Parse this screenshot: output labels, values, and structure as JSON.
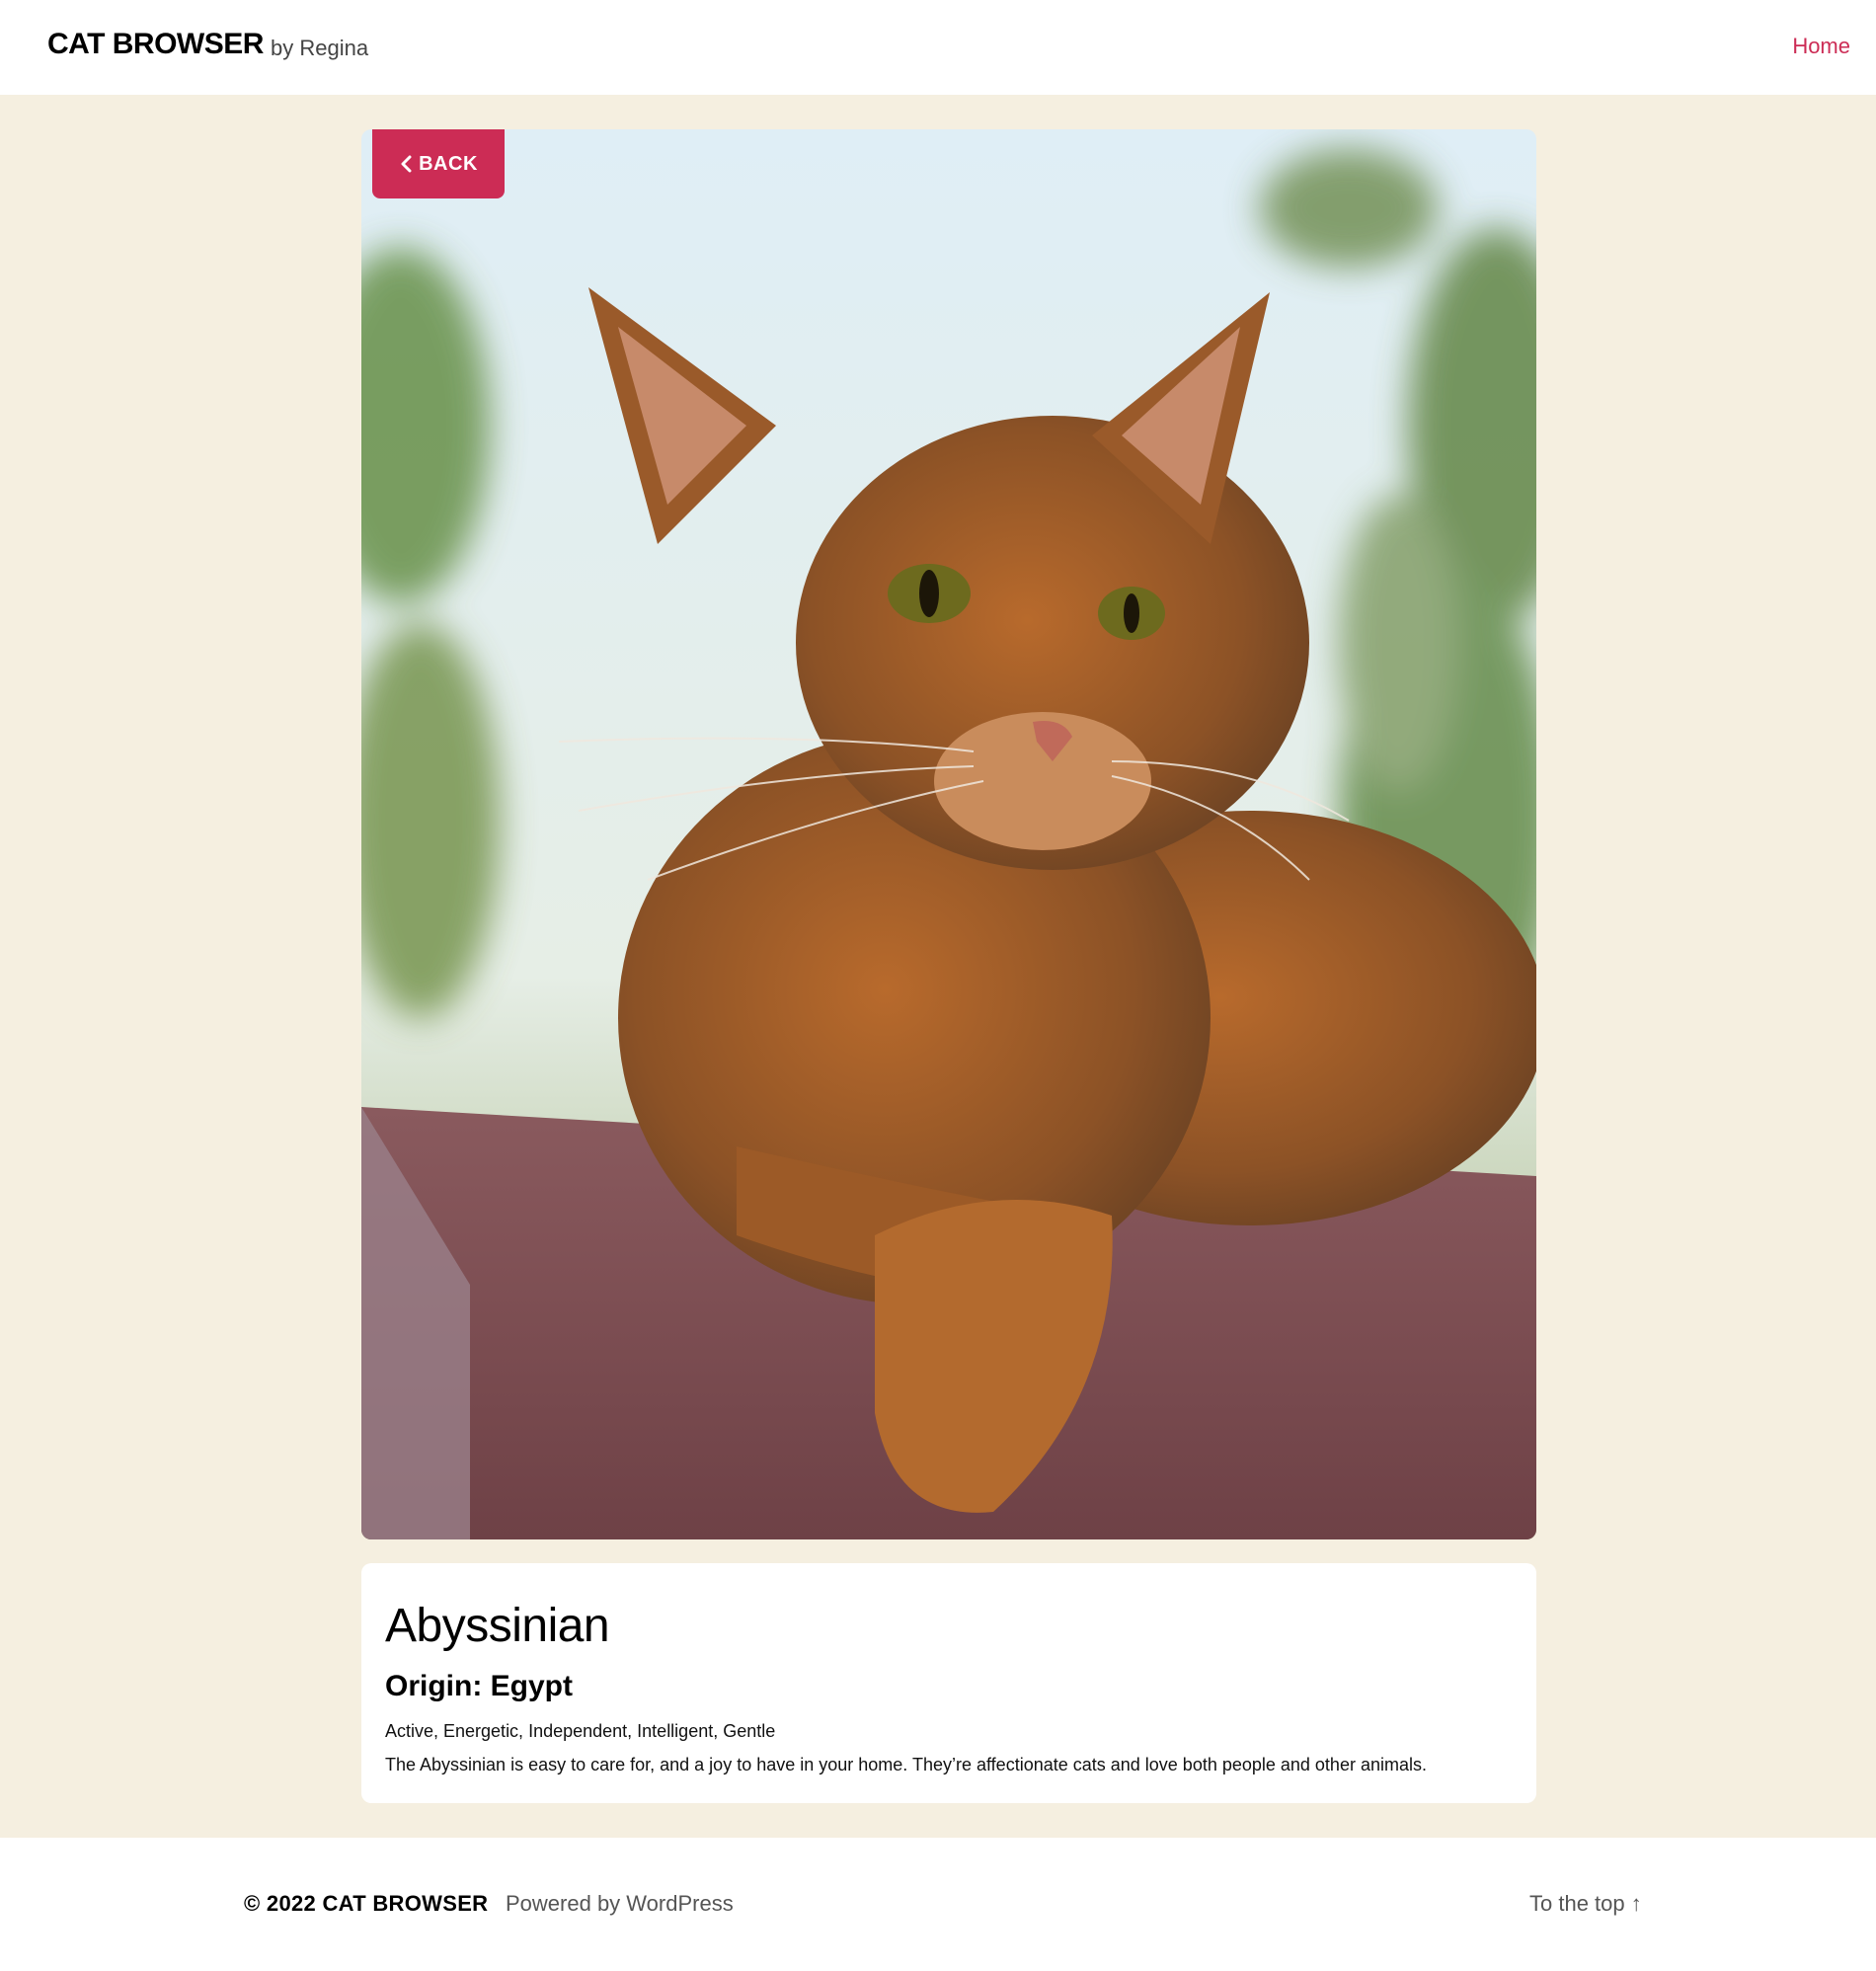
{
  "header": {
    "site_title": "CAT BROWSER",
    "site_description": "by Regina",
    "nav": {
      "home_label": "Home"
    }
  },
  "colors": {
    "accent": "#cc2c55",
    "page_background": "#f5efe0"
  },
  "back_button": {
    "label": "BACK",
    "icon": "chevron-left-icon"
  },
  "breed": {
    "name": "Abyssinian",
    "origin": "Origin: Egypt",
    "temperament": "Active, Energetic, Independent, Intelligent, Gentle",
    "description": "The Abyssinian is easy to care for, and a joy to have in your home. They’re affectionate cats and love both people and other animals."
  },
  "footer": {
    "copyright": "© 2022 CAT BROWSER",
    "powered_by": "Powered by WordPress",
    "to_top": "To the top ↑"
  }
}
